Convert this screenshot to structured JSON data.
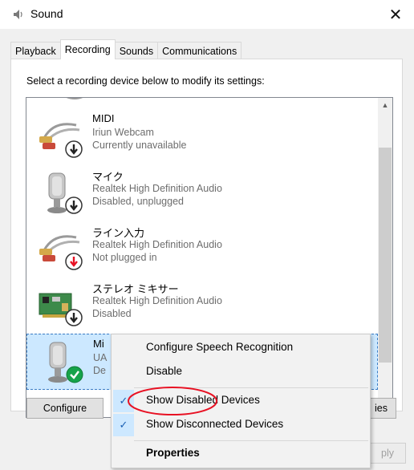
{
  "window": {
    "title": "Sound",
    "close_glyph": "✕"
  },
  "tabs": [
    {
      "label": "Playback",
      "active": false
    },
    {
      "label": "Recording",
      "active": true
    },
    {
      "label": "Sounds",
      "active": false
    },
    {
      "label": "Communications",
      "active": false
    }
  ],
  "instruction": "Select a recording device below to modify its settings:",
  "devices": [
    {
      "name": "MIDI",
      "driver": "Iriun Webcam",
      "status": "Currently unavailable",
      "icon": "rca-cable-icon",
      "status_icon": "down-arrow-badge"
    },
    {
      "name": "マイク",
      "driver": "Realtek High Definition Audio",
      "status": "Disabled, unplugged",
      "icon": "microphone-icon",
      "status_icon": "down-arrow-badge"
    },
    {
      "name": "ライン入力",
      "driver": "Realtek High Definition Audio",
      "status": "Not plugged in",
      "icon": "rca-cable-icon",
      "status_icon": "red-down-arrow-badge"
    },
    {
      "name": "ステレオ ミキサー",
      "driver": "Realtek High Definition Audio",
      "status": "Disabled",
      "icon": "sound-card-icon",
      "status_icon": "down-arrow-badge"
    },
    {
      "name": "Mi",
      "driver": "UA",
      "status": "De",
      "icon": "microphone-icon",
      "status_icon": "green-check-badge"
    }
  ],
  "buttons": {
    "configure": "Configure",
    "properties_partial": "ies",
    "apply_partial": "ply"
  },
  "context_menu": {
    "items": [
      {
        "label": "Configure Speech Recognition",
        "checked": false,
        "bold": false
      },
      {
        "label": "Disable",
        "checked": false,
        "bold": false
      },
      {
        "label": "Show Disabled Devices",
        "checked": true,
        "bold": false
      },
      {
        "label": "Show Disconnected Devices",
        "checked": true,
        "bold": false
      },
      {
        "label": "Properties",
        "checked": false,
        "bold": true
      }
    ],
    "check_glyph": "✓"
  },
  "colors": {
    "selection": "#cce8ff",
    "annotation": "#e81123",
    "check_bg": "#cde8ff",
    "ok_green": "#16a34a"
  }
}
